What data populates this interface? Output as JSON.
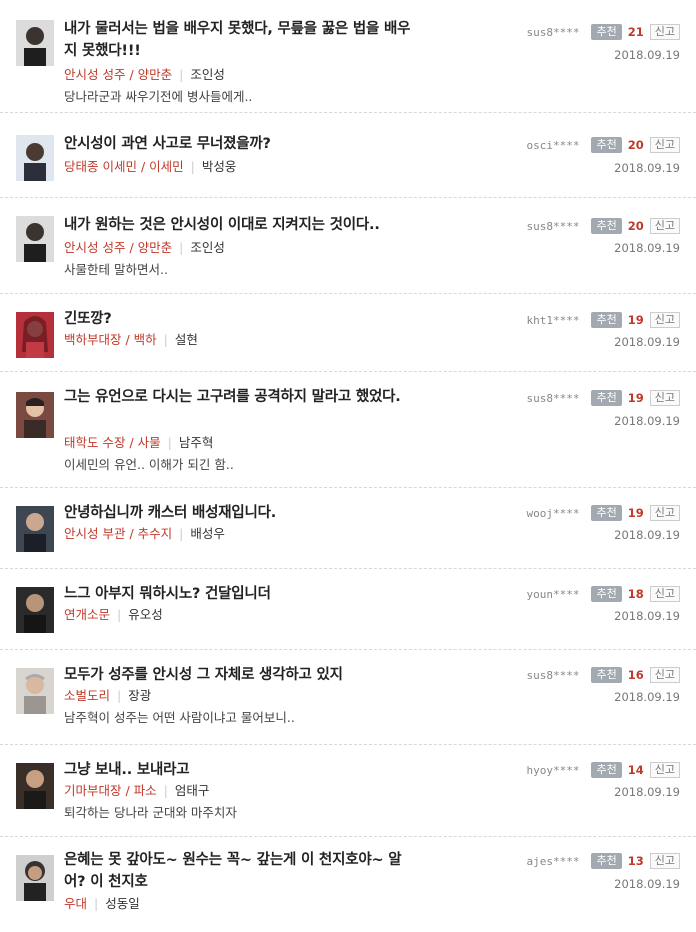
{
  "colors": {
    "role": "#c0392b",
    "recommend_bg": "#a3a9b0",
    "count": "#c0392b"
  },
  "labels": {
    "recommend": "추천",
    "report": "신고"
  },
  "comments": [
    {
      "title": "내가 물러서는 법을 배우지 못했다, 무릎을 꿇은 법을 배우지 못했다!!!",
      "role": "안시성 성주 / 양만춘",
      "actor": "조인성",
      "excerpt": "당나라군과 싸우기전에 병사들에게..",
      "user": "sus8****",
      "recommend": "21",
      "date": "2018.09.19"
    },
    {
      "title": "안시성이 과연 사고로 무너졌을까?",
      "role": "당태종 이세민 / 이세민",
      "actor": "박성웅",
      "excerpt": "",
      "user": "osci****",
      "recommend": "20",
      "date": "2018.09.19"
    },
    {
      "title": "내가 원하는 것은 안시성이 이대로 지켜지는 것이다..",
      "role": "안시성 성주 / 양만춘",
      "actor": "조인성",
      "excerpt": "사물한테 말하면서..",
      "user": "sus8****",
      "recommend": "20",
      "date": "2018.09.19"
    },
    {
      "title": "긴또깡?",
      "role": "백하부대장 / 백하",
      "actor": "설현",
      "excerpt": "",
      "user": "kht1****",
      "recommend": "19",
      "date": "2018.09.19"
    },
    {
      "title": "그는 유언으로 다시는 고구려를 공격하지 말라고 했었다.",
      "role": "태학도 수장 / 사물",
      "actor": "남주혁",
      "excerpt": "이세민의 유언.. 이해가 되긴 함..",
      "user": "sus8****",
      "recommend": "19",
      "date": "2018.09.19"
    },
    {
      "title": "안녕하십니까 캐스터 배성재입니다.",
      "role": "안시성 부관 / 추수지",
      "actor": "배성우",
      "excerpt": "",
      "user": "wooj****",
      "recommend": "19",
      "date": "2018.09.19"
    },
    {
      "title": "느그 아부지 뭐하시노? 건달입니더",
      "role": "연개소문",
      "actor": "유오성",
      "excerpt": "",
      "user": "youn****",
      "recommend": "18",
      "date": "2018.09.19"
    },
    {
      "title": "모두가 성주를 안시성 그 자체로 생각하고 있지",
      "role": "소벌도리",
      "actor": "장광",
      "excerpt": "남주혁이 성주는 어떤 사람이냐고 물어보니..",
      "user": "sus8****",
      "recommend": "16",
      "date": "2018.09.19"
    },
    {
      "title": "그냥 보내.. 보내라고",
      "role": "기마부대장 / 파소",
      "actor": "엄태구",
      "excerpt": "퇴각하는 당나라 군대와 마주치자",
      "user": "hyoy****",
      "recommend": "14",
      "date": "2018.09.19"
    },
    {
      "title": "은혜는 못 갚아도~ 원수는 꼭~ 갚는게 이 천지호야~ 알어? 이 천지호",
      "role": "우대",
      "actor": "성동일",
      "excerpt": "",
      "user": "ajes****",
      "recommend": "13",
      "date": "2018.09.19"
    }
  ]
}
